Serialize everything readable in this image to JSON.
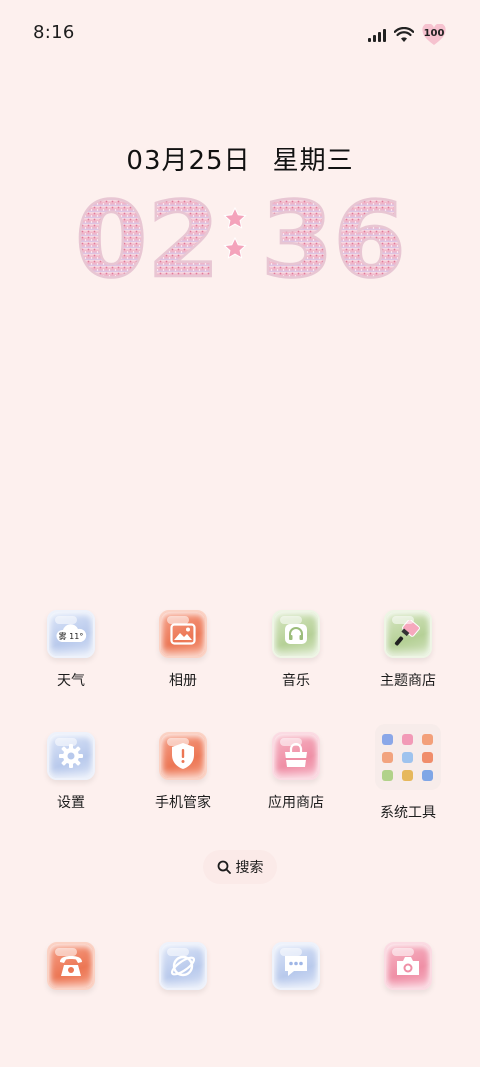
{
  "status_bar": {
    "time": "8:16",
    "battery": "100"
  },
  "lock": {
    "date": "03月25日",
    "weekday": "星期三",
    "clock_hour": "02",
    "clock_minute": "36"
  },
  "apps": [
    {
      "label": "天气",
      "icon": "weather-icon",
      "weather_text": "雾 11°"
    },
    {
      "label": "相册",
      "icon": "gallery-icon"
    },
    {
      "label": "音乐",
      "icon": "headphones-icon"
    },
    {
      "label": "主题商店",
      "icon": "paintbrush-icon"
    },
    {
      "label": "设置",
      "icon": "gear-icon"
    },
    {
      "label": "手机管家",
      "icon": "shield-icon"
    },
    {
      "label": "应用商店",
      "icon": "shopping-bag-icon"
    },
    {
      "label": "系统工具",
      "icon": "folder-icon"
    }
  ],
  "search": {
    "label": "搜索"
  },
  "dock": [
    {
      "icon": "phone-icon"
    },
    {
      "icon": "browser-icon"
    },
    {
      "icon": "message-icon"
    },
    {
      "icon": "camera-icon"
    }
  ],
  "colors": {
    "background": "#fdf0ee",
    "blue_tile": "#b8c9ec",
    "red_tile": "#ec7654",
    "green_tile": "#b5d096",
    "pink_tile": "#ef8ea5",
    "clock_glitter": "#f3a9bd"
  }
}
